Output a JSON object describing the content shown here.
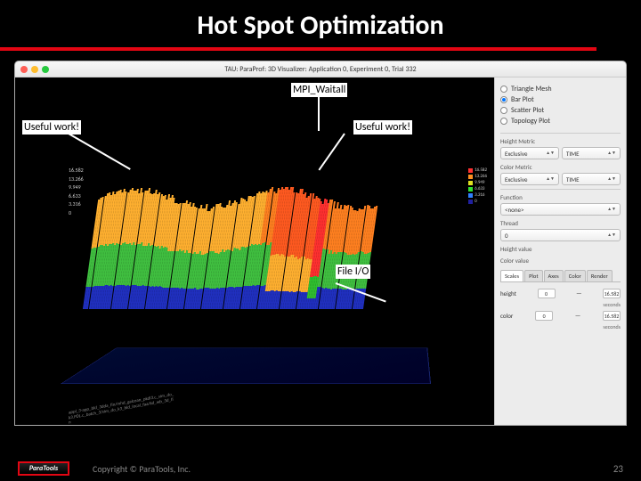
{
  "slide": {
    "title": "Hot Spot Optimization",
    "copyright": "Copyright © ParaTools, Inc.",
    "pagenum": "23",
    "logo": "ParaTools"
  },
  "window": {
    "title": "TAU: ParaProf: 3D Visualizer: Application 0, Experiment 0, Trial 332"
  },
  "annotations": {
    "mpi_waitall": "MPI_Waitall",
    "useful1": "Useful work!",
    "useful2": "Useful work!",
    "fileio": "File I/O"
  },
  "sidebar": {
    "plot_types": [
      {
        "label": "Triangle Mesh",
        "selected": false
      },
      {
        "label": "Bar Plot",
        "selected": true
      },
      {
        "label": "Scatter Plot",
        "selected": false
      },
      {
        "label": "Topology Plot",
        "selected": false
      }
    ],
    "height_metric_label": "Height Metric",
    "height_metric1": "Exclusive",
    "height_metric2": "TIME",
    "color_metric_label": "Color Metric",
    "color_metric1": "Exclusive",
    "color_metric2": "TIME",
    "function_label": "Function",
    "function_value": "<none>",
    "thread_label": "Thread",
    "thread_value": "0",
    "height_value_label": "Height value",
    "color_value_label": "Color value",
    "tabs": [
      "Scales",
      "Plot",
      "Axes",
      "Color",
      "Render"
    ],
    "height_label": "height",
    "height_min": "0",
    "height_max": "16.582",
    "color_label": "color",
    "color_min": "0",
    "color_max": "16.582",
    "seconds": "seconds"
  },
  "axis": {
    "t1": "16.582",
    "t2": "13.266",
    "t3": "9.949",
    "t4": "6.633",
    "t5": "3.316",
    "t6": "0"
  },
  "legend": {
    "l1": "16.582",
    "l2": "13.266",
    "l3": "9.949",
    "l4": "6.633",
    "l5": "3.316",
    "l6": "0"
  },
  "bottom_sample": "appl_3-app_bld_3dda_fin/mhd_galcean_pkdl3.c_sim_do_k3.PDL.c_batch_3/sim_do_k3_bld_local_faa/kd_wb_3d_fin"
}
